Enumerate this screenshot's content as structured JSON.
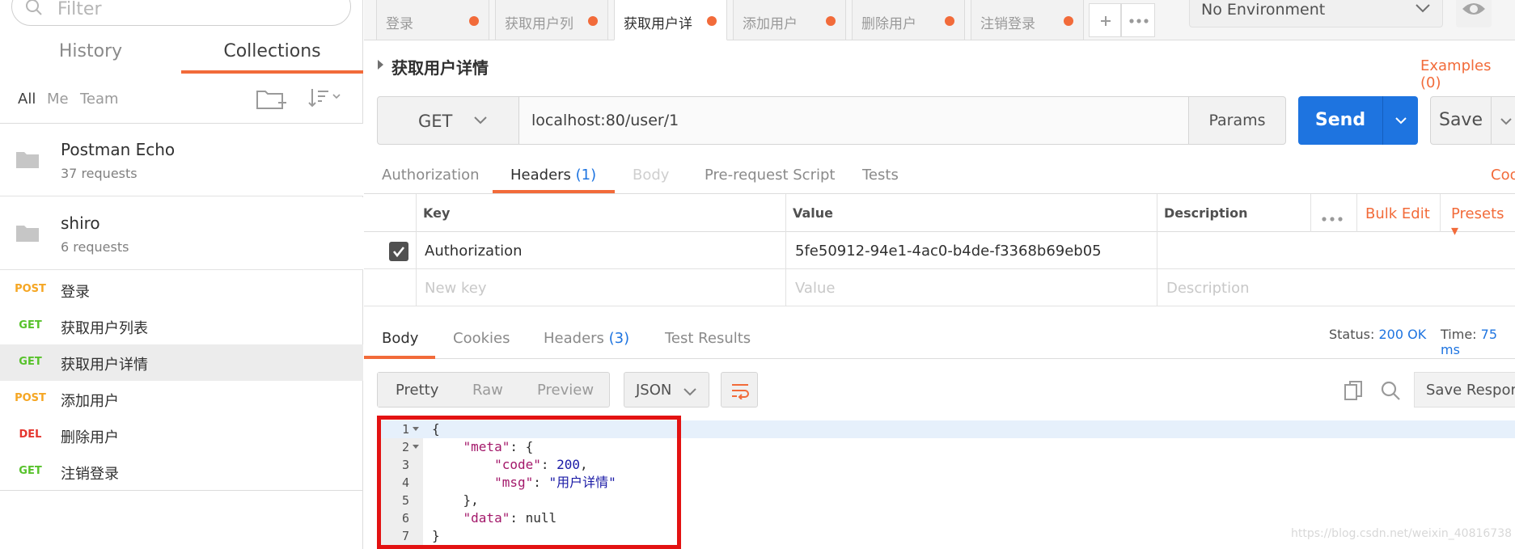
{
  "sidebar": {
    "filter_placeholder": "Filter",
    "tabs": [
      "History",
      "Collections"
    ],
    "scopes": [
      "All",
      "Me",
      "Team"
    ],
    "collections": [
      {
        "name": "Postman Echo",
        "count": "37 requests"
      },
      {
        "name": "shiro",
        "count": "6 requests"
      }
    ],
    "requests": [
      {
        "method": "POST",
        "name": "登录"
      },
      {
        "method": "GET",
        "name": "获取用户列表"
      },
      {
        "method": "GET",
        "name": "获取用户详情"
      },
      {
        "method": "POST",
        "name": "添加用户"
      },
      {
        "method": "DEL",
        "name": "删除用户"
      },
      {
        "method": "GET",
        "name": "注销登录"
      }
    ]
  },
  "tabs_bar": {
    "tabs": [
      "登录",
      "获取用户列",
      "获取用户详",
      "添加用户",
      "删除用户",
      "注销登录"
    ],
    "environment": "No Environment"
  },
  "request": {
    "title": "获取用户详情",
    "examples": "Examples (0)",
    "method": "GET",
    "url": "localhost:80/user/1",
    "params_label": "Params",
    "send_label": "Send",
    "save_label": "Save",
    "tabs": {
      "authorization": "Authorization",
      "headers": "Headers",
      "headers_count": "(1)",
      "body": "Body",
      "pre_request": "Pre-request Script",
      "tests": "Tests",
      "code_link": "Coo"
    },
    "headers_table": {
      "col_key": "Key",
      "col_value": "Value",
      "col_description": "Description",
      "bulk_edit": "Bulk Edit",
      "presets": "Presets",
      "row": {
        "key": "Authorization",
        "value": "5fe50912-94e1-4ac0-b4de-f3368b69eb05"
      },
      "placeholders": {
        "key": "New key",
        "value": "Value",
        "description": "Description"
      }
    }
  },
  "response": {
    "tabs": {
      "body": "Body",
      "cookies": "Cookies",
      "headers": "Headers",
      "headers_count": "(3)",
      "test_results": "Test Results"
    },
    "status_label": "Status:",
    "status_value": "200 OK",
    "time_label": "Time:",
    "time_value": "75 ms",
    "view_modes": [
      "Pretty",
      "Raw",
      "Preview"
    ],
    "format": "JSON",
    "save_response": "Save Response",
    "code_lines": [
      "{",
      "    \"meta\": {",
      "        \"code\": 200,",
      "        \"msg\": \"用户详情\"",
      "    },",
      "    \"data\": null",
      "}"
    ],
    "code": {
      "meta_key": "\"meta\"",
      "code_key": "\"code\"",
      "code_val": "200",
      "msg_key": "\"msg\"",
      "msg_val": "\"用户详情\"",
      "data_key": "\"data\"",
      "data_val": "null"
    }
  },
  "watermark": "https://blog.csdn.net/weixin_40816738",
  "colors": {
    "accent": "#f26b3a",
    "send": "#1e74e0",
    "highlight_box": "#e31212"
  }
}
